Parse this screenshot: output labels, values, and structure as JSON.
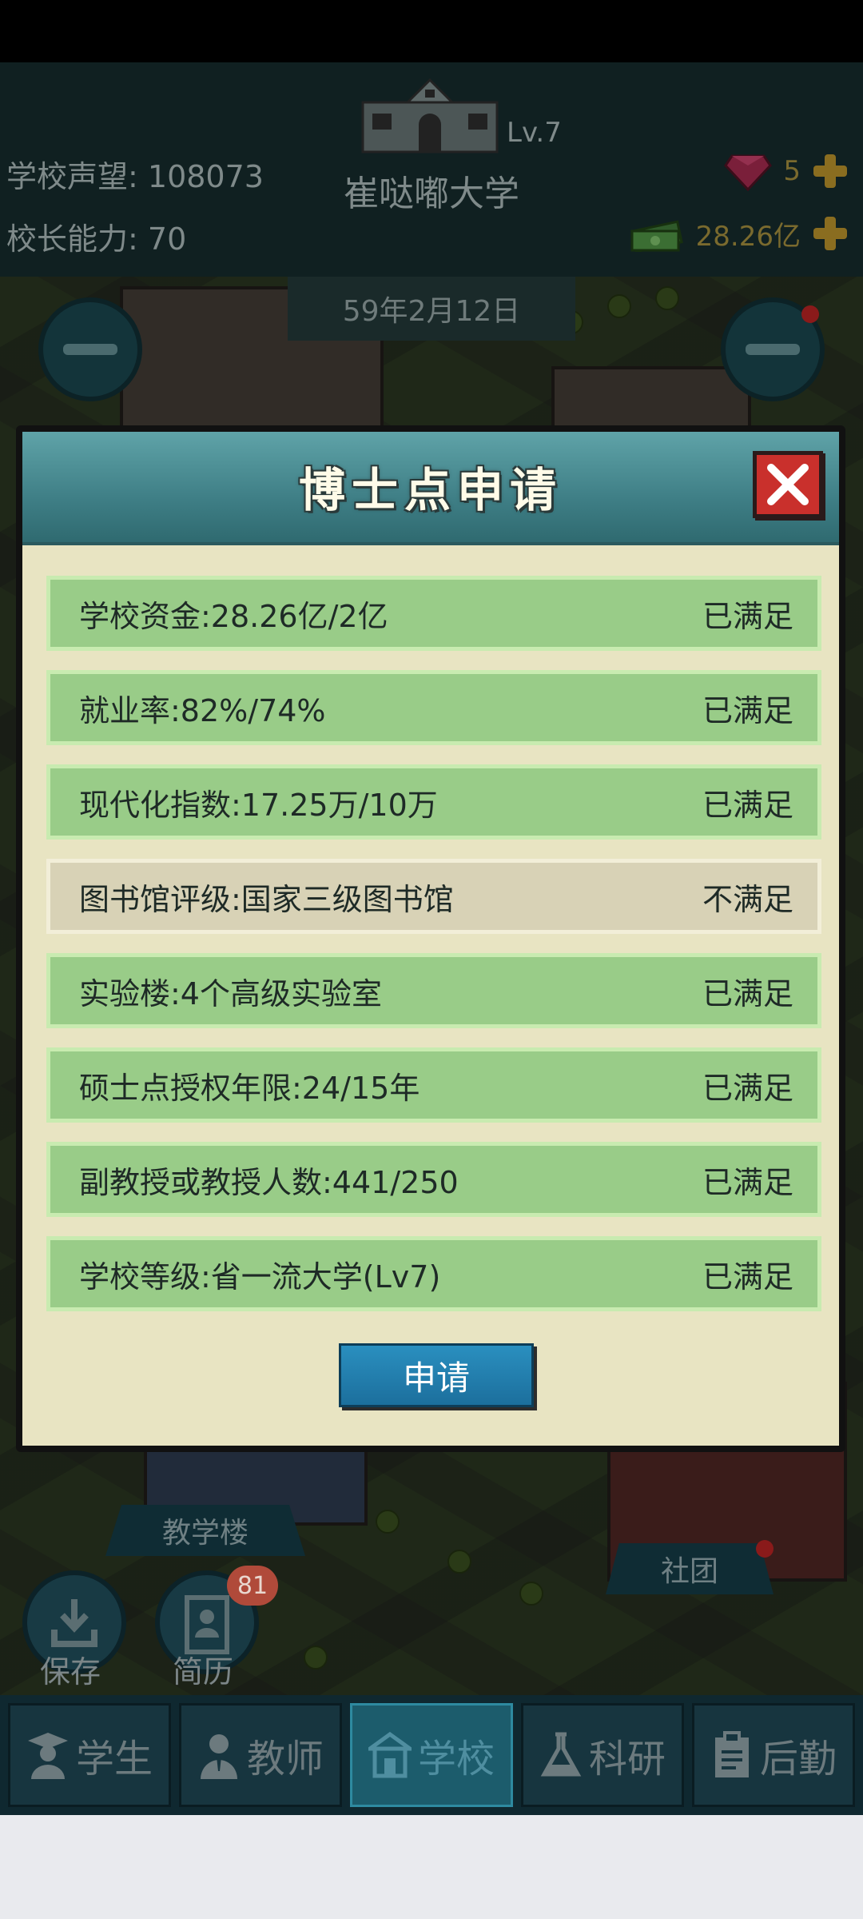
{
  "hud": {
    "reputation_label": "学校声望:",
    "reputation_value": "108073",
    "ability_label": "校长能力:",
    "ability_value": "70",
    "school_level": "Lv.7",
    "school_name": "崔哒嘟大学",
    "gems": "5",
    "money": "28.26亿",
    "date": "59年2月12日"
  },
  "dialog": {
    "title": "博士点申请",
    "requirements": [
      {
        "label": "学校资金:28.26亿/2亿",
        "status": "已满足",
        "met": true
      },
      {
        "label": "就业率:82%/74%",
        "status": "已满足",
        "met": true
      },
      {
        "label": "现代化指数:17.25万/10万",
        "status": "已满足",
        "met": true
      },
      {
        "label": "图书馆评级:国家三级图书馆",
        "status": "不满足",
        "met": false
      },
      {
        "label": "实验楼:4个高级实验室",
        "status": "已满足",
        "met": true
      },
      {
        "label": "硕士点授权年限:24/15年",
        "status": "已满足",
        "met": true
      },
      {
        "label": "副教授或教授人数:441/250",
        "status": "已满足",
        "met": true
      },
      {
        "label": "学校等级:省一流大学(Lv7)",
        "status": "已满足",
        "met": true
      }
    ],
    "apply_label": "申请"
  },
  "scene": {
    "teaching_building": "教学楼",
    "club": "社团",
    "save_label": "保存",
    "resume_label": "简历",
    "resume_badge": "81"
  },
  "nav": {
    "items": [
      {
        "label": "学生",
        "icon": "student-icon"
      },
      {
        "label": "教师",
        "icon": "teacher-icon"
      },
      {
        "label": "学校",
        "icon": "school-icon"
      },
      {
        "label": "科研",
        "icon": "flask-icon"
      },
      {
        "label": "后勤",
        "icon": "clipboard-icon"
      }
    ],
    "active": "学校"
  },
  "colors": {
    "met_row": "#99cc88",
    "unmet_row": "#d8d2b6",
    "header_teal": "#3f7f86",
    "close_red": "#c9302c",
    "apply_blue": "#1c6f9d"
  }
}
